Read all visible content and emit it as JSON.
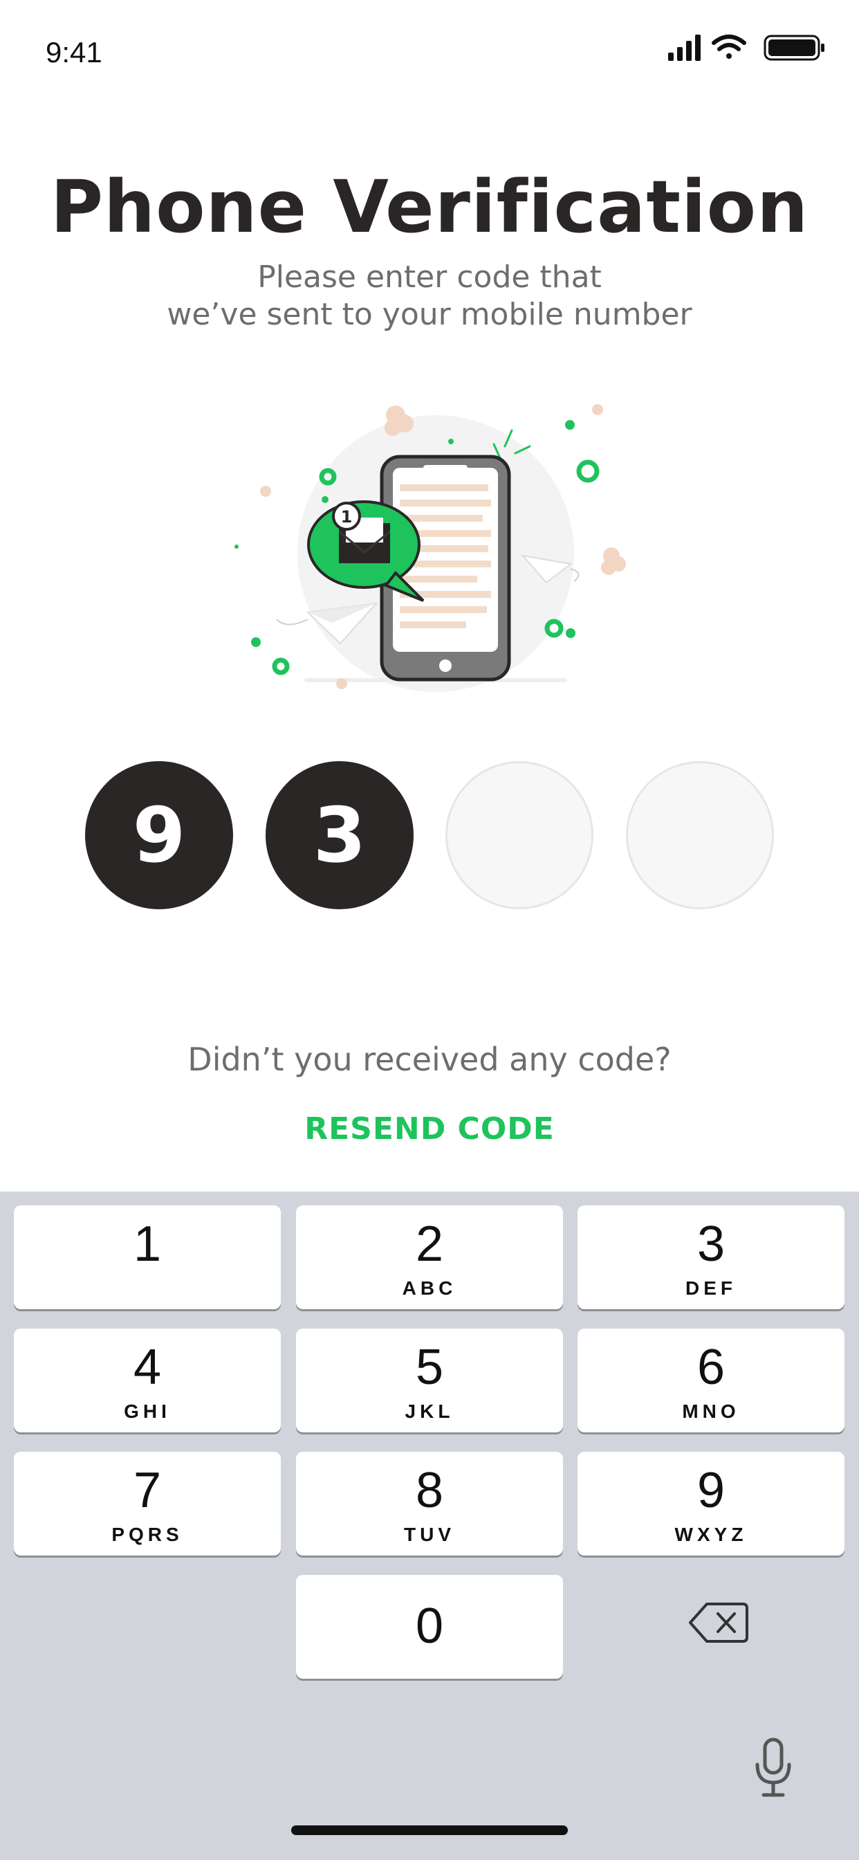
{
  "status_bar": {
    "time": "9:41",
    "icons": [
      "signal-icon",
      "wifi-icon",
      "battery-icon"
    ]
  },
  "header": {
    "title": "Phone Verification",
    "subtitle_line1": "Please enter code that",
    "subtitle_line2": "we’ve sent to your mobile number"
  },
  "illustration": {
    "badge_count": "1"
  },
  "code": {
    "digits": [
      "9",
      "3",
      "",
      ""
    ]
  },
  "resend": {
    "question": "Didn’t you received any code?",
    "link_label": "RESEND CODE"
  },
  "colors": {
    "accent": "#1ec35c",
    "dark": "#2b2626",
    "keyboard_bg": "#d1d4da"
  },
  "keypad": {
    "keys": [
      {
        "digit": "1",
        "letters": ""
      },
      {
        "digit": "2",
        "letters": "ABC"
      },
      {
        "digit": "3",
        "letters": "DEF"
      },
      {
        "digit": "4",
        "letters": "GHI"
      },
      {
        "digit": "5",
        "letters": "JKL"
      },
      {
        "digit": "6",
        "letters": "MNO"
      },
      {
        "digit": "7",
        "letters": "PQRS"
      },
      {
        "digit": "8",
        "letters": "TUV"
      },
      {
        "digit": "9",
        "letters": "WXYZ"
      },
      {
        "digit": "0",
        "letters": ""
      }
    ]
  }
}
